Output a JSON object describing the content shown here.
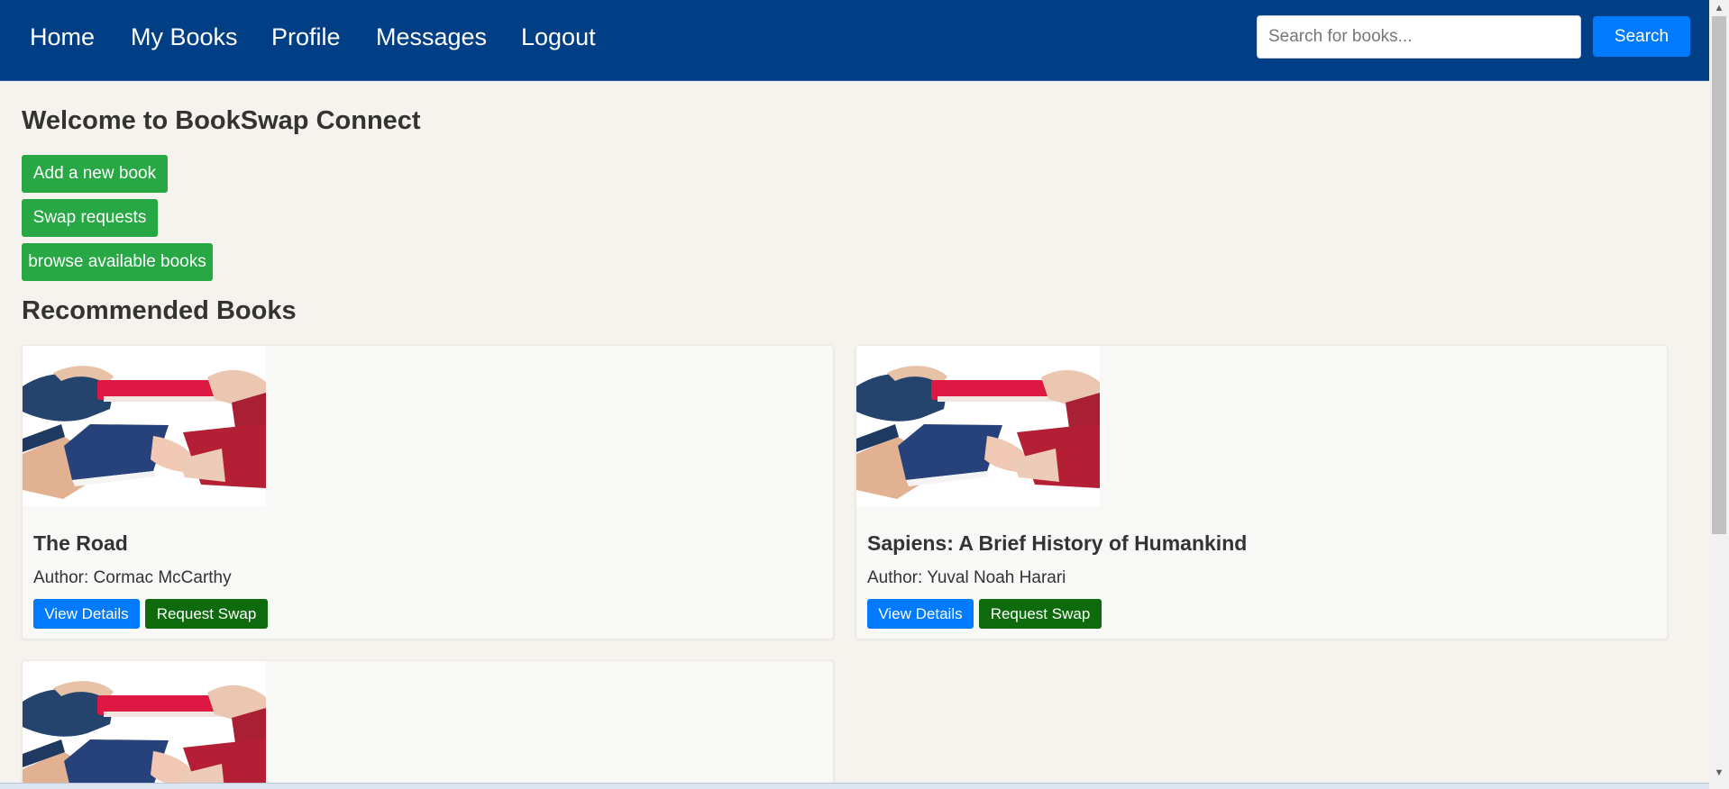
{
  "nav": {
    "links": [
      "Home",
      "My Books",
      "Profile",
      "Messages",
      "Logout"
    ],
    "search_placeholder": "Search for books...",
    "search_button": "Search"
  },
  "main": {
    "welcome": "Welcome to BookSwap Connect",
    "actions": [
      "Add a new book",
      "Swap requests",
      "browse available books"
    ],
    "recommended_title": "Recommended Books"
  },
  "books": [
    {
      "title": "The Road",
      "author": "Author: Cormac McCarthy",
      "view_label": "View Details",
      "swap_label": "Request Swap"
    },
    {
      "title": "Sapiens: A Brief History of Humankind",
      "author": "Author: Yuval Noah Harari",
      "view_label": "View Details",
      "swap_label": "Request Swap"
    },
    {
      "title": "",
      "author": "",
      "view_label": "",
      "swap_label": ""
    }
  ],
  "colors": {
    "navbar": "#003f85",
    "primary_button": "#007bff",
    "success_button": "#28a745",
    "swap_button": "#0d6b0d",
    "page_background": "#f6f3ee"
  }
}
